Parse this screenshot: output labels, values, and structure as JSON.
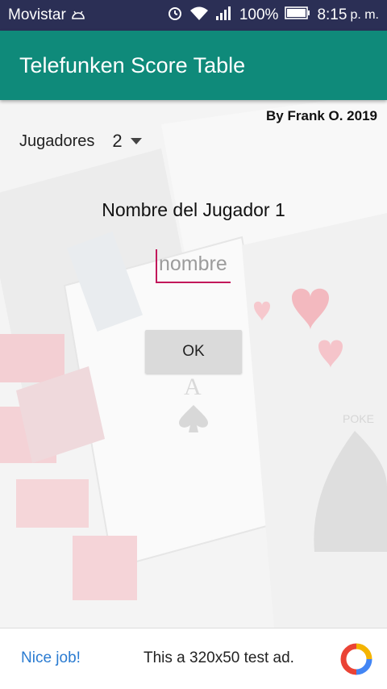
{
  "status_bar": {
    "carrier": "Movistar",
    "battery": "100%",
    "time": "8:15",
    "ampm": "p. m."
  },
  "app_bar": {
    "title": "Telefunken Score Table"
  },
  "credit": "By Frank O. 2019",
  "players": {
    "label": "Jugadores",
    "value": "2"
  },
  "player_name": {
    "label": "Nombre del Jugador 1",
    "placeholder": "nombre",
    "value": ""
  },
  "ok_button": {
    "label": "OK"
  },
  "ad": {
    "link": "Nice job!",
    "text": "This a 320x50 test ad."
  },
  "colors": {
    "status_bar": "#2b2f55",
    "app_bar": "#0f8a7a",
    "input_accent": "#c2185b",
    "ad_link": "#2a7bd1"
  }
}
